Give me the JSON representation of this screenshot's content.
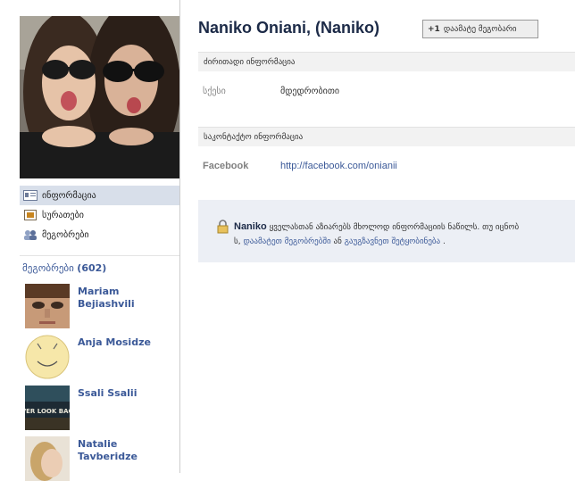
{
  "profile": {
    "name": "Naniko Oniani, (Naniko)"
  },
  "header": {
    "add_friend_plus": "+1",
    "add_friend_label": "დაამატე მეგობარი"
  },
  "nav": {
    "items": [
      {
        "label": "ინფორმაცია",
        "icon": "info-card-icon",
        "active": true
      },
      {
        "label": "სურათები",
        "icon": "photos-icon",
        "active": false
      },
      {
        "label": "მეგობრები",
        "icon": "friends-icon",
        "active": false
      }
    ]
  },
  "friends": {
    "heading": "მეგობრები",
    "count": "(602)",
    "list": [
      {
        "name": "Mariam Bejiashvili"
      },
      {
        "name": "Anja Mosidze"
      },
      {
        "name": "Ssali Ssalii"
      },
      {
        "name": "Natalie Tavberidze"
      }
    ],
    "thumb_text_ssali": "EVER LOOK BACK"
  },
  "basic_info": {
    "heading": "ძირითადი ინფორმაცია",
    "sex_label": "სქესი",
    "sex_value": "მდედრობითი"
  },
  "contact_info": {
    "heading": "საკონტაქტო ინფორმაცია",
    "fb_label": "Facebook",
    "fb_url": "http://facebook.com/onianii"
  },
  "privacy": {
    "name": "Naniko",
    "line1": "ყველასთან აზიარებს მხოლოდ ინფორმაციის ნაწილს. თუ იცნობ",
    "line2_prefix": "ს, ",
    "line2_link1": "დაამატეთ მეგობრებში",
    "line2_mid": " ან ",
    "line2_link2": "გაუგზავნეთ შეტყობინება",
    "line2_suffix": " ."
  },
  "colors": {
    "link": "#3b5998",
    "title": "#1c2a47",
    "nav_active_bg": "#d8dfea",
    "privacy_bg": "#eceff5"
  }
}
